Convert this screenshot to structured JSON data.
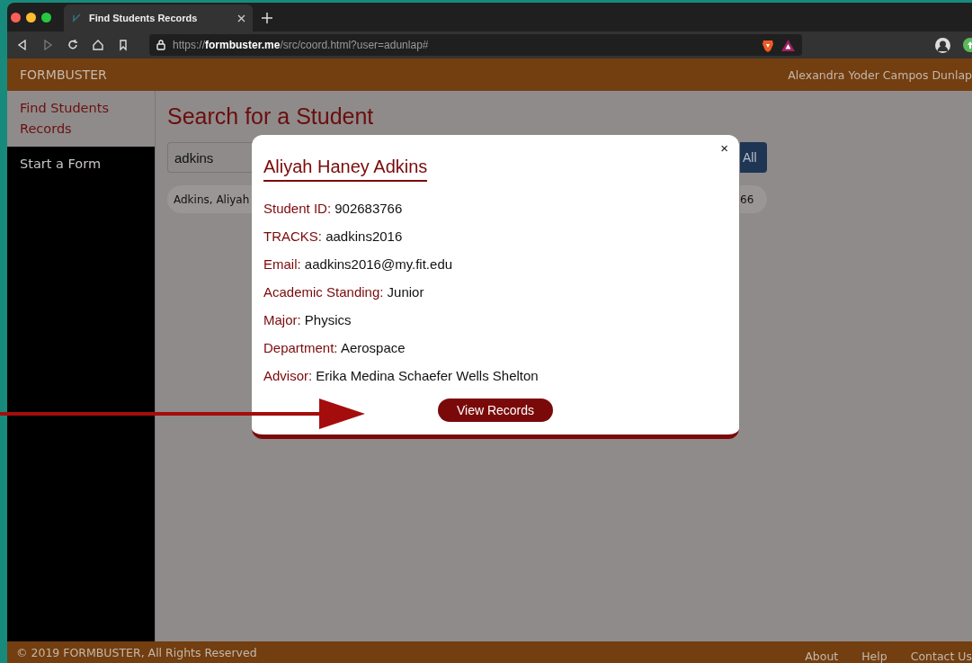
{
  "browser": {
    "tab": {
      "title": "Find Students Records"
    },
    "url": "https://**formbuster.me**/src/coord.html?user=adunlap#"
  },
  "header": {
    "brand": "FORMBUSTER",
    "user": "Alexandra Yoder Campos Dunlap"
  },
  "sidebar": {
    "items": [
      {
        "label": "Find Students Records",
        "selected": true
      },
      {
        "label": "Start a Form",
        "selected": false
      }
    ]
  },
  "page": {
    "title": "Search for a Student",
    "search": {
      "value": "adkins"
    },
    "search_button": "All",
    "result": {
      "name": "Adkins, Aliyah",
      "id_end": "66"
    }
  },
  "modal": {
    "close": "×",
    "name": "Aliyah Haney Adkins",
    "fields": [
      {
        "label": "Student ID:",
        "value": "902683766"
      },
      {
        "label": "TRACKS:",
        "value": "aadkins2016"
      },
      {
        "label": "Email:",
        "value": "aadkins2016@my.fit.edu"
      },
      {
        "label": "Academic Standing:",
        "value": "Junior"
      },
      {
        "label": "Major:",
        "value": "Physics"
      },
      {
        "label": "Department:",
        "value": "Aerospace"
      },
      {
        "label": "Advisor:",
        "value": "Erika Medina Schaefer Wells Shelton"
      }
    ],
    "button": "View Records"
  },
  "footer": {
    "copyright": "© 2019 FORMBUSTER, All Rights Reserved",
    "links": [
      "About",
      "Help",
      "Contact Us"
    ]
  }
}
